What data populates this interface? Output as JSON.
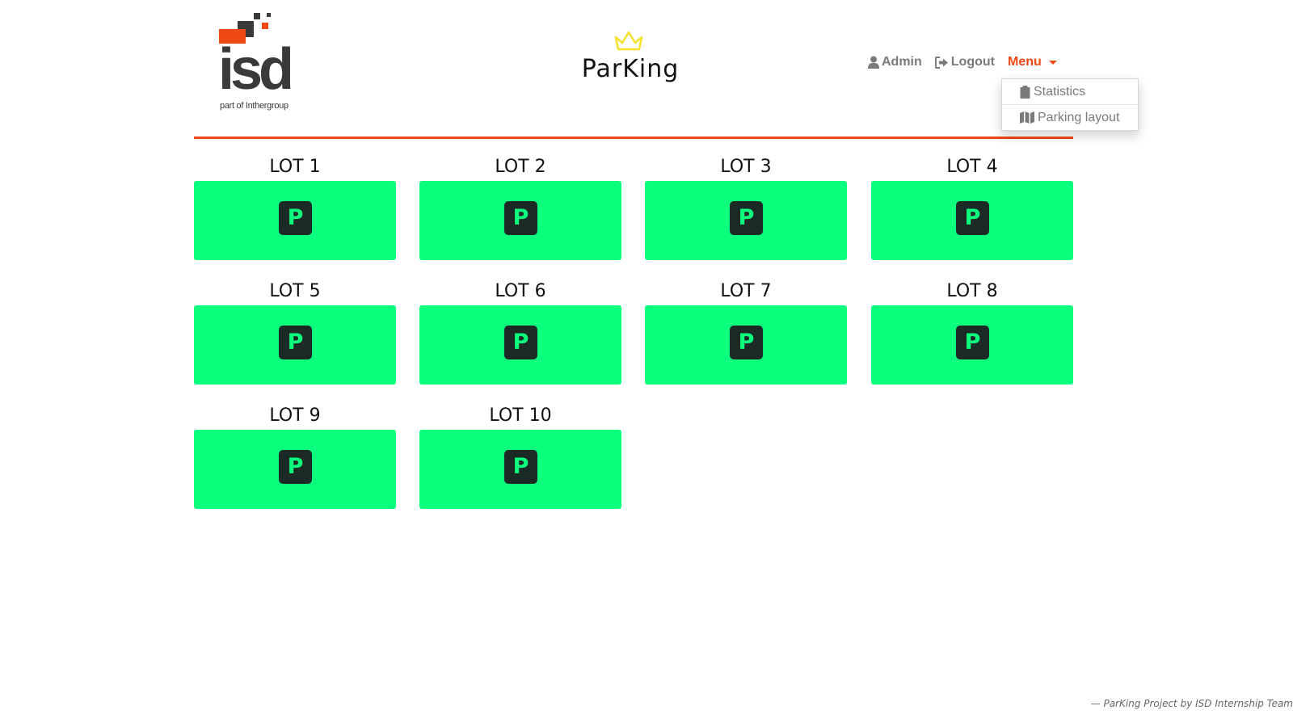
{
  "brand": {
    "isd_text": "isd",
    "isd_subtitle": "part of Inthergroup",
    "app_name": "ParKing",
    "accent_color": "#ee4814",
    "crown_color": "#f5e12a"
  },
  "nav": {
    "admin_label": "Admin",
    "logout_label": "Logout",
    "menu_label": "Menu"
  },
  "menu_dropdown": {
    "items": [
      {
        "label": "Statistics",
        "icon": "clipboard-icon"
      },
      {
        "label": "Parking layout",
        "icon": "map-icon"
      }
    ]
  },
  "lots": [
    {
      "label": "LOT 1",
      "status": "free",
      "icon_text": "P"
    },
    {
      "label": "LOT 2",
      "status": "free",
      "icon_text": "P"
    },
    {
      "label": "LOT 3",
      "status": "free",
      "icon_text": "P"
    },
    {
      "label": "LOT 4",
      "status": "free",
      "icon_text": "P"
    },
    {
      "label": "LOT 5",
      "status": "free",
      "icon_text": "P"
    },
    {
      "label": "LOT 6",
      "status": "free",
      "icon_text": "P"
    },
    {
      "label": "LOT 7",
      "status": "free",
      "icon_text": "P"
    },
    {
      "label": "LOT 8",
      "status": "free",
      "icon_text": "P"
    },
    {
      "label": "LOT 9",
      "status": "free",
      "icon_text": "P"
    },
    {
      "label": "LOT 10",
      "status": "free",
      "icon_text": "P"
    }
  ],
  "colors": {
    "free_slot": "#0aff7d",
    "parking_icon_bg": "#1c2a26"
  },
  "footer": {
    "text": "— ParKing Project by ISD Internship Team"
  }
}
